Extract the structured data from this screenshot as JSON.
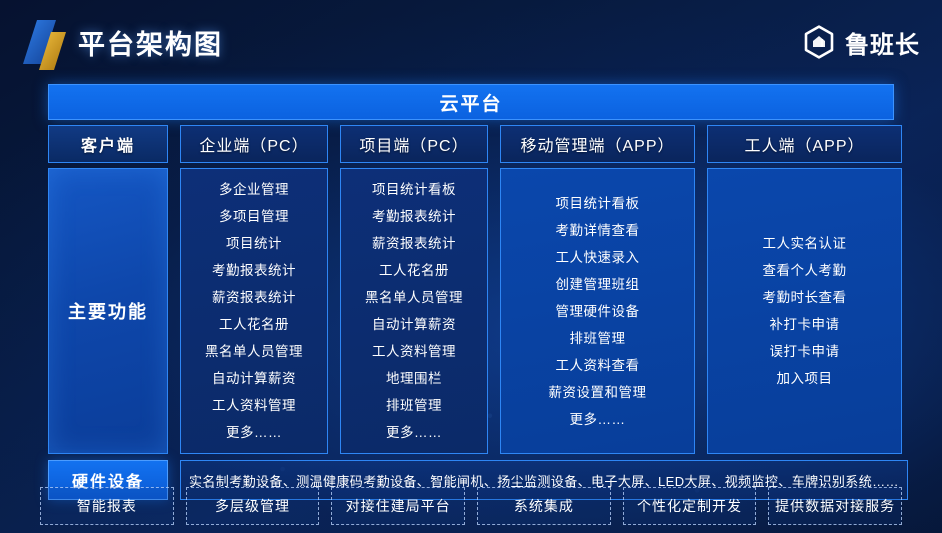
{
  "header": {
    "title": "平台架构图",
    "brand_name": "鲁班长",
    "brand_mark_icon": "slanted-bars-logo-icon",
    "logo_badge_icon": "hexagon-building-icon"
  },
  "arch": {
    "cloud_label": "云平台",
    "row_labels": {
      "client": "客户端",
      "main_functions": "主要功能",
      "hardware": "硬件设备"
    },
    "columns": [
      {
        "header": "企业端（PC）",
        "features": [
          "多企业管理",
          "多项目管理",
          "项目统计",
          "考勤报表统计",
          "薪资报表统计",
          "工人花名册",
          "黑名单人员管理",
          "自动计算薪资",
          "工人资料管理",
          "更多……"
        ]
      },
      {
        "header": "项目端（PC）",
        "features": [
          "项目统计看板",
          "考勤报表统计",
          "薪资报表统计",
          "工人花名册",
          "黑名单人员管理",
          "自动计算薪资",
          "工人资料管理",
          "地理围栏",
          "排班管理",
          "更多……"
        ]
      },
      {
        "header": "移动管理端（APP）",
        "features": [
          "项目统计看板",
          "考勤详情查看",
          "工人快速录入",
          "创建管理班组",
          "管理硬件设备",
          "排班管理",
          "工人资料查看",
          "薪资设置和管理",
          "更多……"
        ]
      },
      {
        "header": "工人端（APP）",
        "features": [
          "工人实名认证",
          "查看个人考勤",
          "考勤时长查看",
          "补打卡申请",
          "误打卡申请",
          "加入项目"
        ]
      }
    ],
    "hardware_value": "实名制考勤设备、测温健康码考勤设备、智能闸机、扬尘监测设备、电子大屏、LED大屏、视频监控、车牌识别系统……",
    "services": [
      "智能报表",
      "多层级管理",
      "对接住建局平台",
      "系统集成",
      "个性化定制开发",
      "提供数据对接服务"
    ]
  },
  "colors": {
    "accent_blue": "#1372f0",
    "border_blue": "#2e86f5",
    "bg_navy": "#071a3e",
    "bright_column": "#0a47ac",
    "brand_gold": "#d9a017"
  }
}
